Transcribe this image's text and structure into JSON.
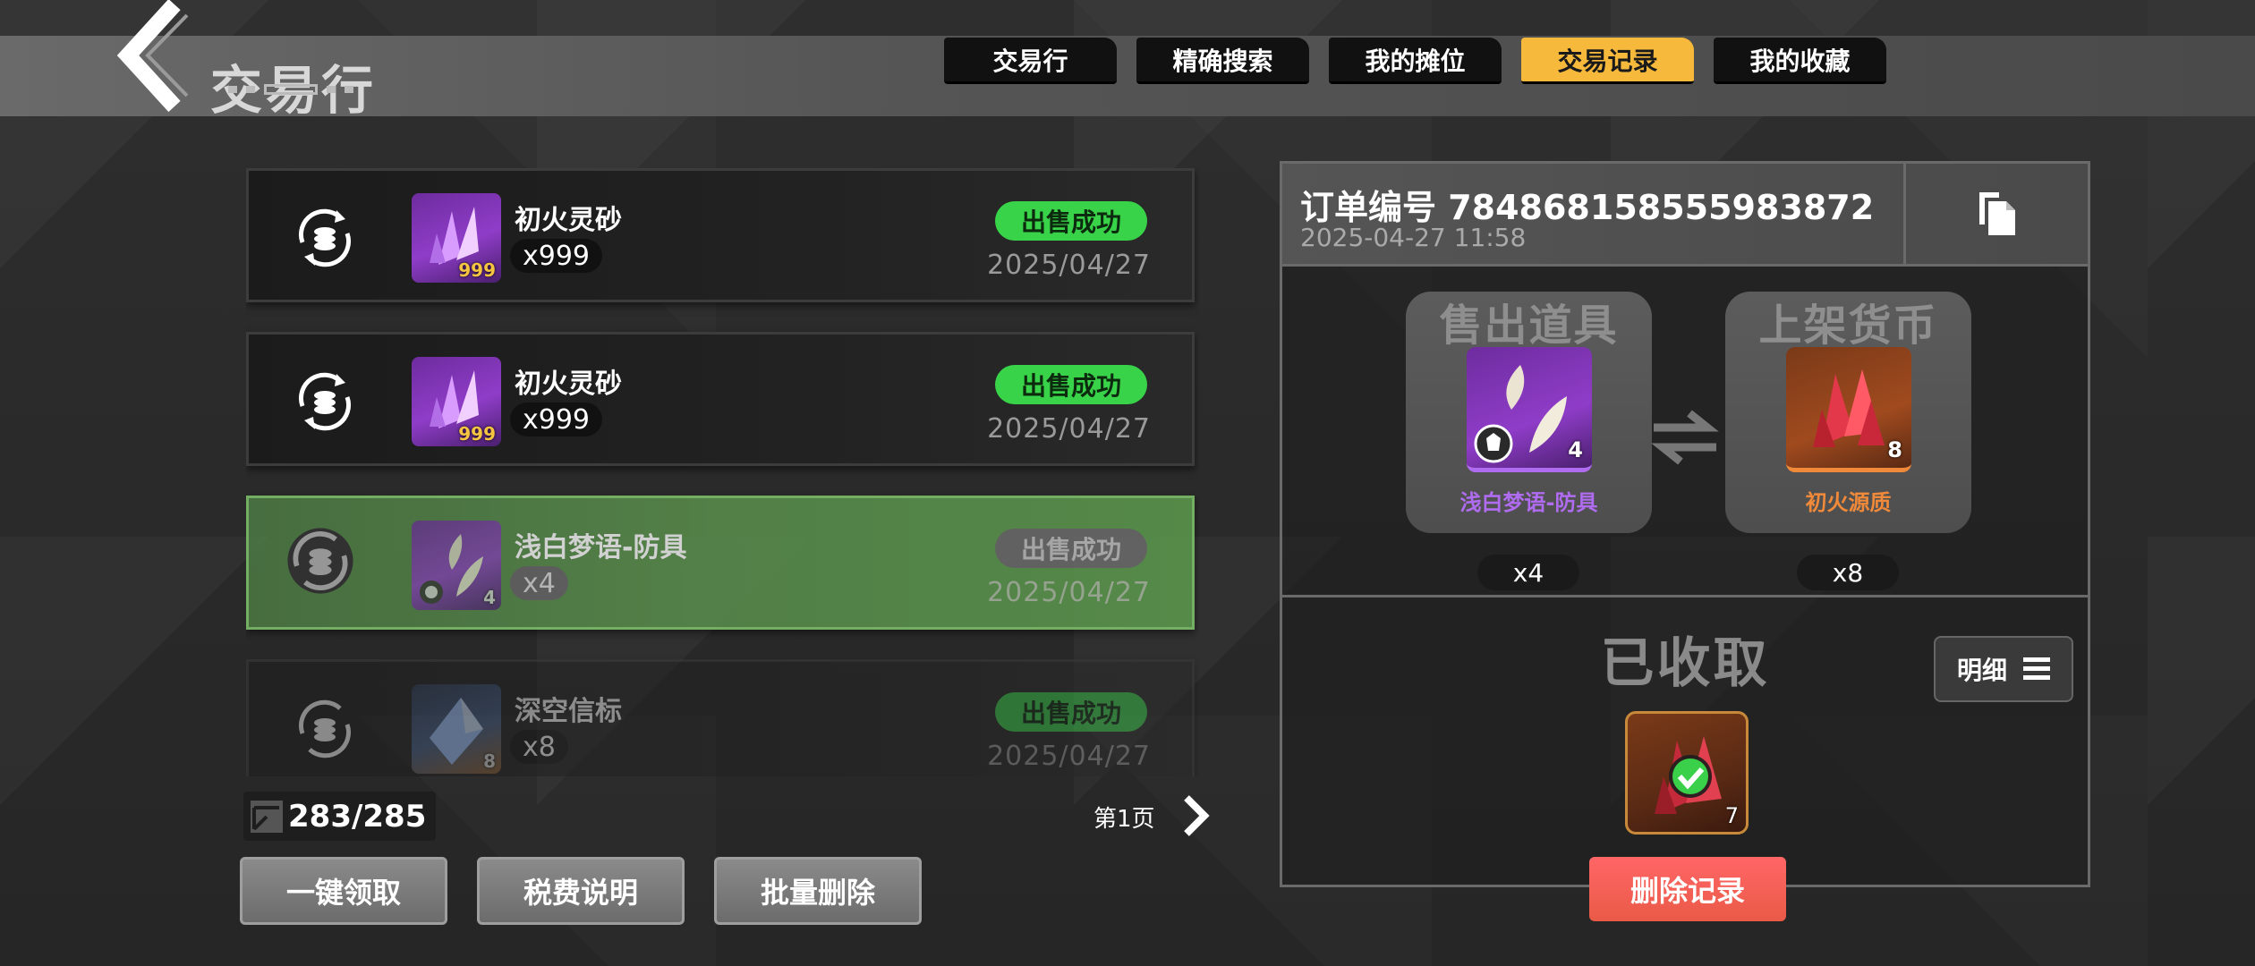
{
  "header": {
    "title": "交易行",
    "tabs": [
      {
        "label": "交易行",
        "active": false
      },
      {
        "label": "精确搜索",
        "active": false
      },
      {
        "label": "我的摊位",
        "active": false
      },
      {
        "label": "交易记录",
        "active": true
      },
      {
        "label": "我的收藏",
        "active": false
      }
    ]
  },
  "records": [
    {
      "name": "初火灵砂",
      "count": "x999",
      "thumb_qty": "999",
      "status": "出售成功",
      "date": "2025/04/27",
      "state": "normal",
      "icon": "purple-crystal-icon"
    },
    {
      "name": "初火灵砂",
      "count": "x999",
      "thumb_qty": "999",
      "status": "出售成功",
      "date": "2025/04/27",
      "state": "normal",
      "icon": "purple-crystal-icon"
    },
    {
      "name": "浅白梦语-防具",
      "count": "x4",
      "thumb_qty": "4",
      "status": "出售成功",
      "date": "2025/04/27",
      "state": "selected",
      "icon": "white-feather-armor-icon"
    },
    {
      "name": "深空信标",
      "count": "x8",
      "thumb_qty": "8",
      "status": "出售成功",
      "date": "2025/04/27",
      "state": "faded",
      "icon": "blue-beacon-icon"
    }
  ],
  "footer": {
    "counter": "283/285",
    "page_label": "第1页",
    "buttons": {
      "claim_all": "一键领取",
      "tax_info": "税费说明",
      "batch_delete": "批量删除"
    }
  },
  "detail": {
    "order_no": "订单编号 784868158555983872",
    "order_time": "2025-04-27 11:58",
    "sold": {
      "title": "售出道具",
      "name": "浅白梦语-防具",
      "qty": "4",
      "count": "x4",
      "name_color": "#b06cf0"
    },
    "listed": {
      "title": "上架货币",
      "name": "初火源质",
      "qty": "8",
      "count": "x8",
      "name_color": "#f08a3a"
    },
    "collected_title": "已收取",
    "detail_label": "明细",
    "collected_qty": "7",
    "delete_label": "删除记录"
  },
  "colors": {
    "tab_active": "#f7b93b",
    "status_green": "#39d34a",
    "delete_red": "#ef5d4a",
    "selected_green": "#5a8f4d"
  }
}
